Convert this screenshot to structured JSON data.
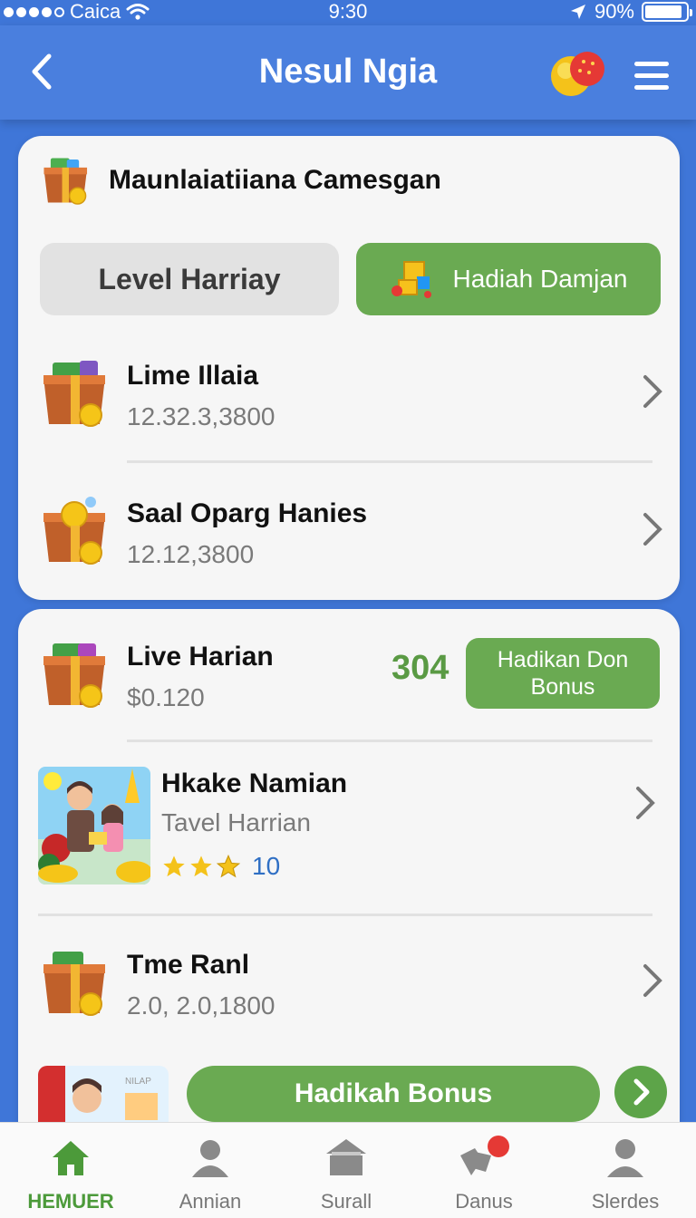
{
  "status": {
    "carrier": "Caica",
    "time": "9:30",
    "battery": "90%",
    "battery_level": 0.9
  },
  "header": {
    "title": "Nesul Ngia"
  },
  "card1": {
    "title": "Maunlaiatiiana Camesgan",
    "tab_gray": "Level Harriay",
    "tab_green": "Hadiah Damjan",
    "rows": [
      {
        "title": "Lime Illaia",
        "sub": "12.32.3,3800"
      },
      {
        "title": "Saal Oparg Hanies",
        "sub": "12.12,3800"
      }
    ]
  },
  "card2": {
    "live": {
      "title": "Live Harian",
      "sub": "$0.120",
      "number": "304",
      "button_line1": "Hadikan Don",
      "button_line2": "Bonus"
    },
    "feature": {
      "title": "Hkake Namian",
      "sub": "Tavel Harrian",
      "rating": 3,
      "count": "10"
    },
    "time": {
      "title": "Tme Ranl",
      "sub": "2.0, 2.0,1800"
    },
    "bonus_button": "Hadikah Bonus",
    "strip_text": "NILAP"
  },
  "tabbar": [
    {
      "label": "HEMUER",
      "icon": "home-icon",
      "active": true
    },
    {
      "label": "Annian",
      "icon": "person-icon",
      "active": false
    },
    {
      "label": "Surall",
      "icon": "store-icon",
      "active": false
    },
    {
      "label": "Danus",
      "icon": "bonus-icon",
      "active": false
    },
    {
      "label": "Slerdes",
      "icon": "profile-icon",
      "active": false
    }
  ],
  "colors": {
    "primary_blue": "#4a7fde",
    "green": "#6aaa52",
    "number_green": "#5a9a44",
    "link_blue": "#2f6fc4"
  }
}
